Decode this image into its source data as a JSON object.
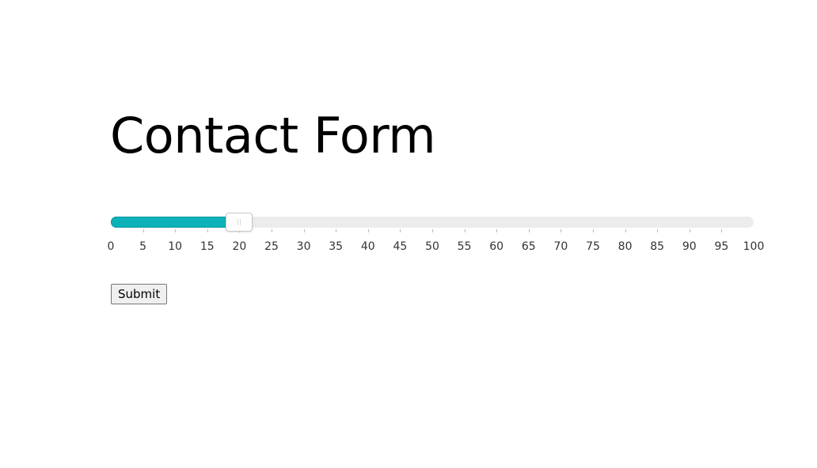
{
  "page": {
    "title": "Contact Form"
  },
  "slider": {
    "min": 0,
    "max": 100,
    "step": 5,
    "value": 20,
    "fill_color": "#0db2b8",
    "track_color": "#ececec",
    "tick_labels": [
      "0",
      "5",
      "10",
      "15",
      "20",
      "25",
      "30",
      "35",
      "40",
      "45",
      "50",
      "55",
      "60",
      "65",
      "70",
      "75",
      "80",
      "85",
      "90",
      "95",
      "100"
    ]
  },
  "form": {
    "submit_label": "Submit"
  }
}
